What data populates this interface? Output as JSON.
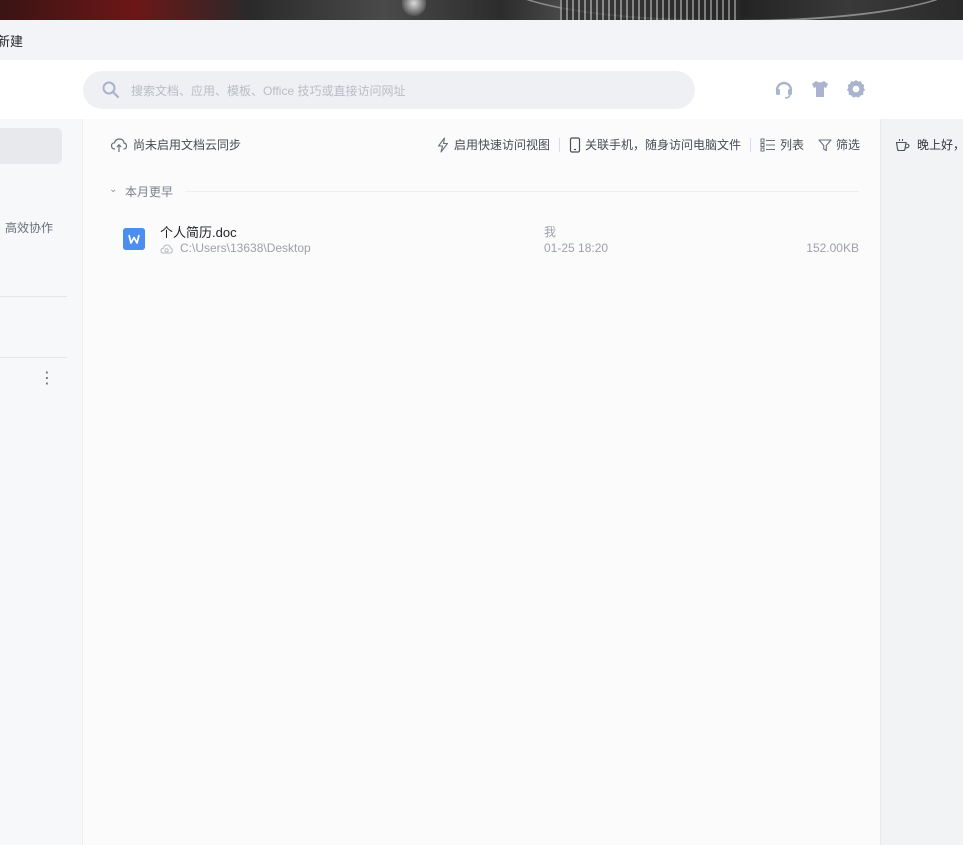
{
  "tabs": {
    "new_tab_label": "新建"
  },
  "search": {
    "placeholder": "搜索文档、应用、模板、Office 技巧或直接访问网址"
  },
  "header_icons": [
    "headset-icon",
    "tshirt-icon",
    "gear-icon"
  ],
  "sidebar": {
    "label": "高效协作"
  },
  "toolbar": {
    "cloud_sync": "尚未启用文档云同步",
    "quick_access": "启用快速访问视图",
    "phone_link": "关联手机，随身访问电脑文件",
    "list_view": "列表",
    "filter": "筛选"
  },
  "section": {
    "label": "本月更早"
  },
  "files": [
    {
      "name": "个人简历.doc",
      "path": "C:\\Users\\13638\\Desktop",
      "owner": "我",
      "time": "01-25 18:20",
      "size": "152.00KB"
    }
  ],
  "right_panel": {
    "greeting": "晚上好，"
  },
  "colors": {
    "accent": "#4b8ef0",
    "icon": "#aab4cf"
  }
}
